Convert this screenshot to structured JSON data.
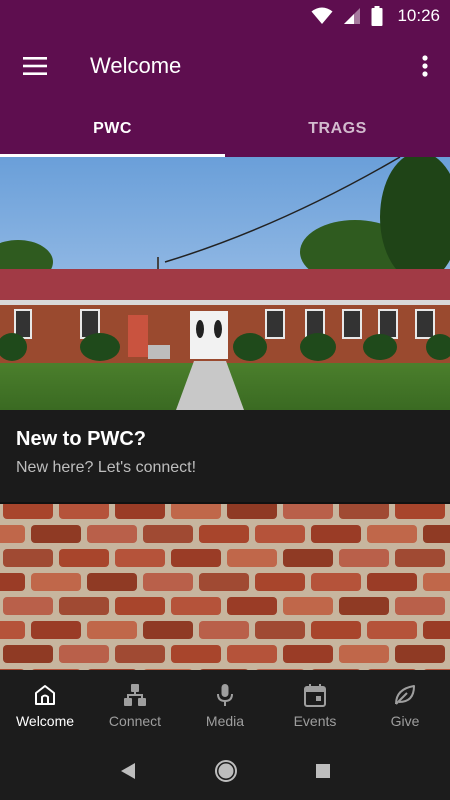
{
  "status_bar": {
    "time": "10:26"
  },
  "app_bar": {
    "title": "Welcome"
  },
  "tabs": [
    {
      "label": "PWC",
      "active": true
    },
    {
      "label": "TRAGS",
      "active": false
    }
  ],
  "cards": [
    {
      "headline": "New to PWC?",
      "subtext": "New here? Let's connect!"
    }
  ],
  "bottom_nav": [
    {
      "label": "Welcome",
      "icon": "home-icon",
      "active": true
    },
    {
      "label": "Connect",
      "icon": "connect-icon",
      "active": false
    },
    {
      "label": "Media",
      "icon": "microphone-icon",
      "active": false
    },
    {
      "label": "Events",
      "icon": "calendar-icon",
      "active": false
    },
    {
      "label": "Give",
      "icon": "leaf-icon",
      "active": false
    }
  ],
  "colors": {
    "brand": "#5e0e4f",
    "nav_bg": "#1c1c1c",
    "card_bg": "#1b1b1b"
  }
}
